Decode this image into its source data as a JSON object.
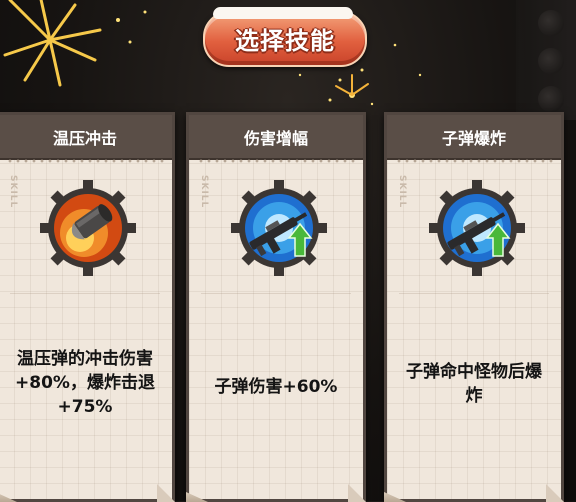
{
  "title": "选择技能",
  "skill_tag": "SKILL",
  "cards": [
    {
      "name": "温压冲击",
      "description": [
        "温压弹的冲击伤害",
        "+80%，爆炸击退",
        "+75%"
      ],
      "icon": "thermobaric-bullet-icon"
    },
    {
      "name": "伤害增幅",
      "description": [
        "子弹伤害+60%"
      ],
      "icon": "rifle-upgrade-icon"
    },
    {
      "name": "子弹爆炸",
      "description": [
        "子弹命中怪物后爆",
        "炸"
      ],
      "icon": "rifle-upgrade-icon"
    }
  ],
  "colors": {
    "banner": "#e1603f",
    "card_header": "#5a4e47",
    "card_paper": "#f0e7dc",
    "fire_orange": "#e8621c",
    "blue_burst": "#3aa0e8",
    "upgrade_green": "#49b83a"
  }
}
